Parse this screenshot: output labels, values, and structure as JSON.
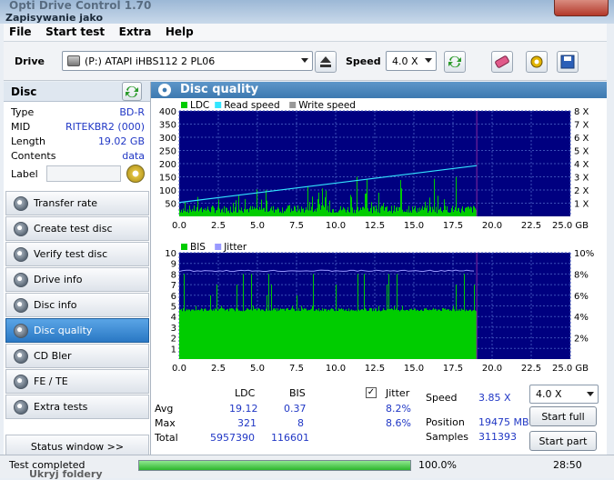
{
  "window": {
    "title": "Opti Drive Control 1.70",
    "behind_text": "Zapisywanie jako",
    "below_text": "Ukryj foldery"
  },
  "menu": [
    "File",
    "Start test",
    "Extra",
    "Help"
  ],
  "toolbar": {
    "drive_label": "Drive",
    "drive_value": "(P:)  ATAPI iHBS112  2 PL06",
    "speed_label": "Speed",
    "speed_value": "4.0 X"
  },
  "disc": {
    "header": "Disc",
    "props": [
      {
        "k": "Type",
        "v": "BD-R"
      },
      {
        "k": "MID",
        "v": "RITEKBR2 (000)"
      },
      {
        "k": "Length",
        "v": "19.02 GB"
      },
      {
        "k": "Contents",
        "v": "data"
      }
    ],
    "label_label": "Label"
  },
  "nav": [
    "Transfer rate",
    "Create test disc",
    "Verify test disc",
    "Drive info",
    "Disc info",
    "Disc quality",
    "CD Bler",
    "FE / TE",
    "Extra tests"
  ],
  "nav_active": 5,
  "status_window_button": "Status window >>",
  "main": {
    "header": "Disc quality"
  },
  "chart_data": [
    {
      "type": "bar",
      "legend": [
        "LDC",
        "Read speed",
        "Write speed"
      ],
      "colors": {
        "LDC": "#00cc00",
        "Read speed": "#33e6ff",
        "Write speed": "#999999"
      },
      "x_ticks": [
        "0.0",
        "2.5",
        "5.0",
        "7.5",
        "10.0",
        "12.5",
        "15.0",
        "17.5",
        "20.0",
        "22.5",
        "25.0 GB"
      ],
      "xlim": [
        0,
        25
      ],
      "y_left_ticks": [
        "400",
        "350",
        "300",
        "250",
        "200",
        "150",
        "100",
        "50"
      ],
      "ylim": [
        0,
        400
      ],
      "y_right_ticks": [
        "8 X",
        "7 X",
        "6 X",
        "5 X",
        "4 X",
        "3 X",
        "2 X",
        "1 X"
      ],
      "data_end": 19.02,
      "ldc_base": [
        12,
        30
      ],
      "read_speed": [
        [
          0,
          1.05
        ],
        [
          19.02,
          3.85
        ]
      ]
    },
    {
      "type": "bar",
      "legend": [
        "BIS",
        "Jitter"
      ],
      "colors": {
        "BIS": "#00cc00",
        "Jitter": "#9999ff"
      },
      "x_ticks": [
        "0.0",
        "2.5",
        "5.0",
        "7.5",
        "10.0",
        "12.5",
        "15.0",
        "17.5",
        "20.0",
        "22.5",
        "25.0 GB"
      ],
      "xlim": [
        0,
        25
      ],
      "y_left_ticks": [
        "10",
        "9",
        "8",
        "7",
        "6",
        "5",
        "4",
        "3",
        "2",
        "1"
      ],
      "ylim": [
        0,
        10
      ],
      "y_right_ticks": [
        "10%",
        "8%",
        "6%",
        "4%",
        "2%"
      ],
      "data_end": 19.02,
      "bis_base": 4.5,
      "jitter": 8.3
    }
  ],
  "stats": {
    "col_ldc": "LDC",
    "col_bis": "BIS",
    "jitter_label": "Jitter",
    "rows": [
      {
        "label": "Avg",
        "ldc": "19.12",
        "bis": "0.37",
        "jitter": "8.2%"
      },
      {
        "label": "Max",
        "ldc": "321",
        "bis": "8",
        "jitter": "8.6%"
      },
      {
        "label": "Total",
        "ldc": "5957390",
        "bis": "116601",
        "jitter": ""
      }
    ],
    "speed_label": "Speed",
    "speed_value": "3.85 X",
    "position_label": "Position",
    "position_value": "19475 MB",
    "samples_label": "Samples",
    "samples_value": "311393",
    "speed_select": "4.0 X",
    "start_full": "Start full",
    "start_part": "Start part"
  },
  "status": {
    "text": "Test completed",
    "progress": 100,
    "progress_text": "100.0%",
    "time": "28:50"
  }
}
